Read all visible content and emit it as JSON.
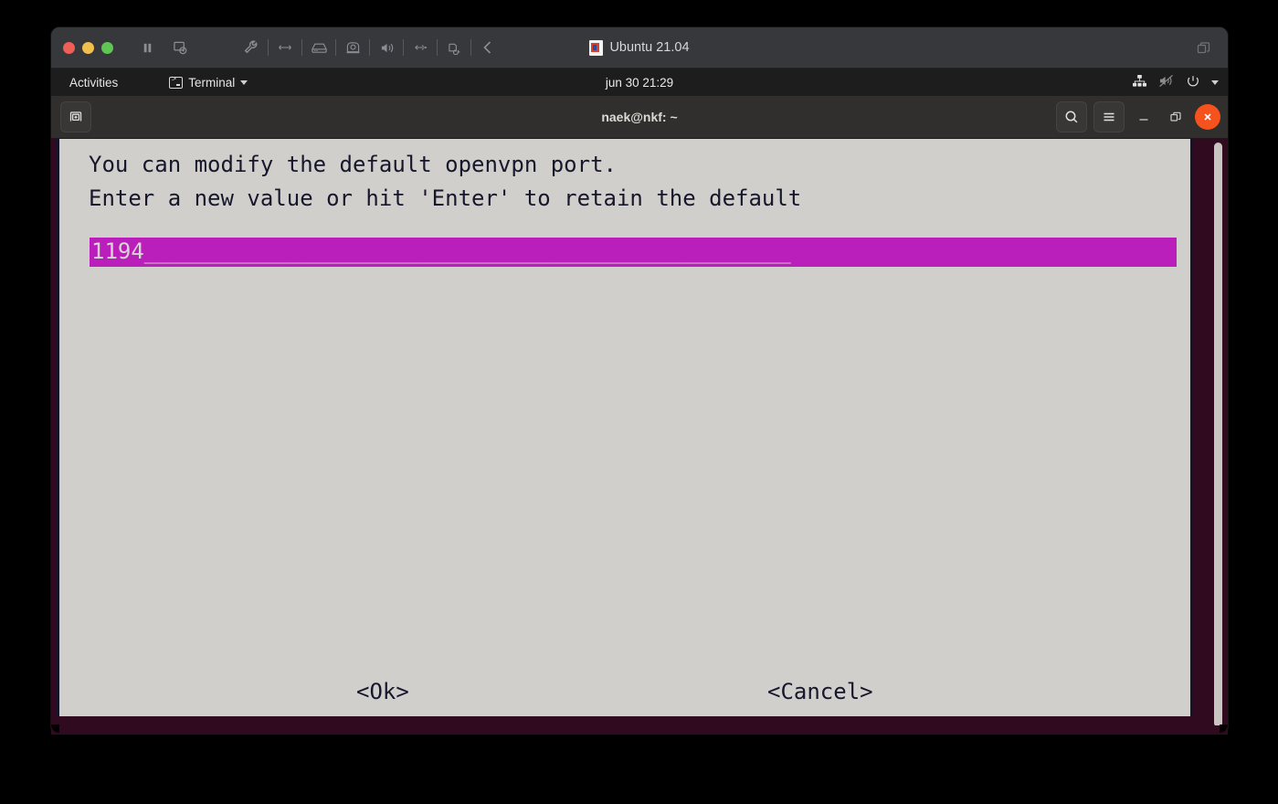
{
  "vm_chrome": {
    "title": "Ubuntu 21.04",
    "title_icon": "vm-document-icon",
    "traffic_lights": [
      "close-button",
      "minimize-button",
      "maximize-button"
    ],
    "toolbar_icons": [
      "pause-icon",
      "snapshot-icon",
      "settings-wrench-icon",
      "network-icon",
      "harddisk-icon",
      "camera-icon",
      "sound-icon",
      "usb-icon",
      "printer-icon",
      "back-chevron-icon"
    ],
    "restore_icon": "restore-window-icon"
  },
  "gnome_panel": {
    "activities_label": "Activities",
    "app_menu_label": "Terminal",
    "app_icon": "terminal-icon",
    "app_menu_chevron": "chevron-down-icon",
    "clock": "jun 30  21:29",
    "status_icons": [
      "network-wired-icon",
      "volume-muted-icon",
      "power-icon",
      "chevron-down-icon"
    ]
  },
  "terminal_window": {
    "title": "naek@nkf: ~",
    "new_tab_icon": "new-tab-icon",
    "search_icon": "search-icon",
    "menu_icon": "hamburger-menu-icon",
    "minimize_icon": "minimize-icon",
    "restore_icon": "restore-icon",
    "close_icon": "close-icon"
  },
  "dialog": {
    "line1": "You can modify the default openvpn port.",
    "line2": "Enter a new value or hit 'Enter' to retain the default",
    "input_value": "1194",
    "input_underscores": "    _________________________________________________",
    "ok_label": "<Ok>",
    "cancel_label": "<Cancel>"
  },
  "colors": {
    "dialog_bg": "#d0cfcc",
    "dialog_text": "#17172b",
    "input_bg": "#bb1fbb",
    "terminal_bg": "#300a1e",
    "close_button": "#f6521d"
  }
}
